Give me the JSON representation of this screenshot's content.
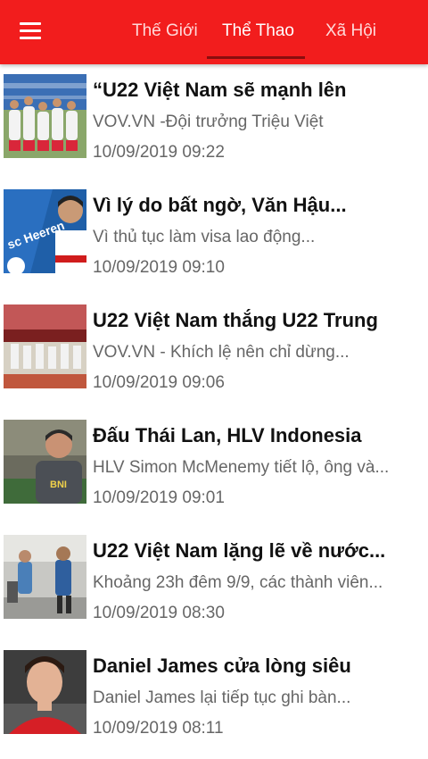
{
  "header": {
    "tabs": [
      {
        "label": "Thế Giới",
        "active": false
      },
      {
        "label": "Thể Thao",
        "active": true
      },
      {
        "label": "Xã Hội",
        "active": false
      }
    ],
    "accent_color": "#f21d1d"
  },
  "articles": [
    {
      "title": "“U22 Việt Nam sẽ mạnh lên",
      "summary": "VOV.VN -Đội trưởng Triệu Việt",
      "time": "10/09/2019 09:22"
    },
    {
      "title": "Vì lý do bất ngờ, Văn Hậu...",
      "summary": "Vì thủ tục làm visa lao động...",
      "time": "10/09/2019 09:10"
    },
    {
      "title": "U22 Việt Nam thắng U22 Trung",
      "summary": "VOV.VN - Khích lệ nên chỉ dừng...",
      "time": "10/09/2019 09:06"
    },
    {
      "title": "Đấu Thái Lan, HLV Indonesia",
      "summary": "HLV Simon McMenemy tiết lộ, ông và...",
      "time": "10/09/2019 09:01"
    },
    {
      "title": "U22 Việt Nam lặng lẽ về nước...",
      "summary": "Khoảng 23h đêm 9/9, các thành viên...",
      "time": "10/09/2019 08:30"
    },
    {
      "title": "Daniel James cửa lòng siêu",
      "summary": "Daniel James lại tiếp tục ghi bàn...",
      "time": "10/09/2019 08:11"
    }
  ],
  "thumb_text": {
    "club": "sc Heeren",
    "sponsor": "BNI"
  }
}
